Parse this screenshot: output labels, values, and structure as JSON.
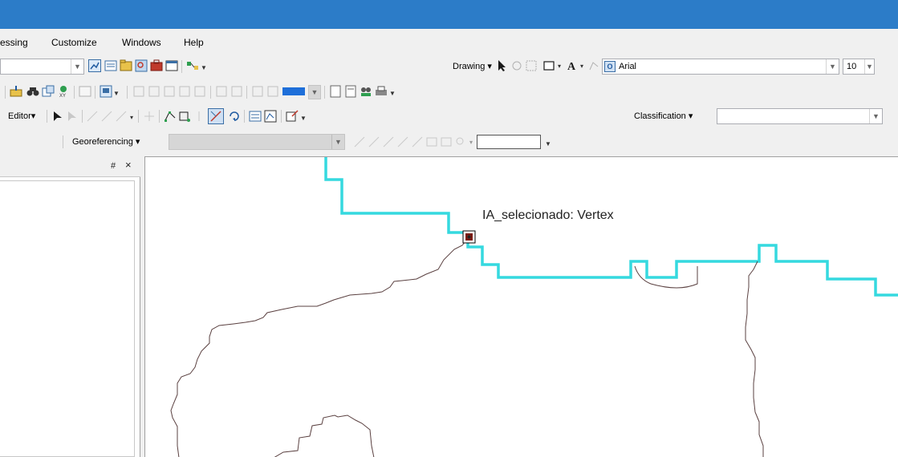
{
  "window": {
    "titlebar_color": "#2c7cc8"
  },
  "menu": {
    "items": [
      "essing",
      "Customize",
      "Windows",
      "Help"
    ]
  },
  "toolbars": {
    "drawing_label": "Drawing",
    "font_name": "Arial",
    "font_size": "10",
    "editor_label": "Editor",
    "classification_label": "Classification",
    "georeferencing_label": "Georeferencing",
    "color_swatch": "#1e6fd9"
  },
  "panel": {
    "pin": "#",
    "close": "×"
  },
  "map": {
    "snap_tip": "IA_selecionado: Vertex",
    "boundary_color": "#35d9df",
    "outline_color": "#5a4040",
    "background": "#ffffff"
  }
}
